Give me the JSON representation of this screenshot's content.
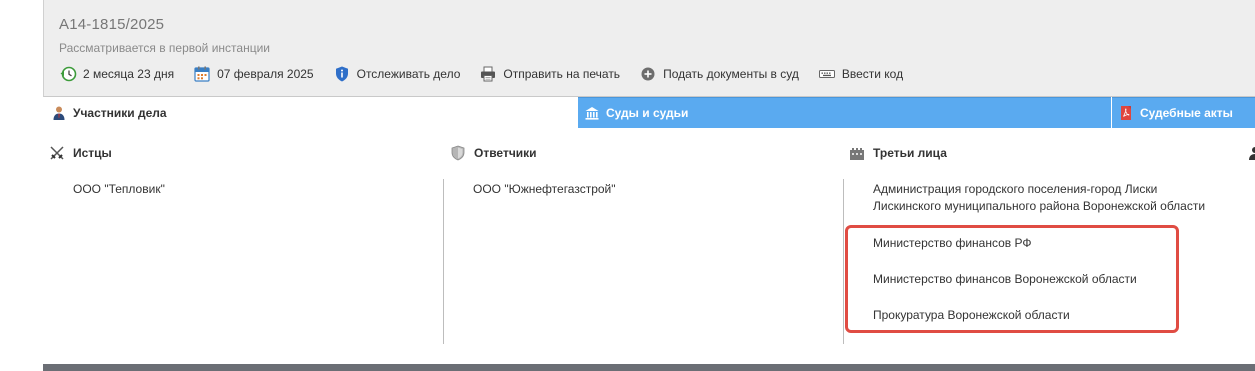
{
  "case": {
    "number": "А14-1815/2025",
    "status": "Рассматривается в первой инстанции"
  },
  "actions": [
    {
      "label": "2 месяца 23 дня",
      "icon": "clock-back-icon"
    },
    {
      "label": "07 февраля 2025",
      "icon": "calendar-icon"
    },
    {
      "label": "Отслеживать дело",
      "icon": "shield-info-icon"
    },
    {
      "label": "Отправить на печать",
      "icon": "printer-icon"
    },
    {
      "label": "Подать документы в суд",
      "icon": "plus-circle-icon"
    },
    {
      "label": "Ввести код",
      "icon": "keyboard-icon"
    }
  ],
  "tabs": {
    "participants": "Участники дела",
    "courts": "Суды и судьи",
    "acts": "Судебные акты"
  },
  "columns": {
    "plaintiffs": {
      "title": "Истцы",
      "items": [
        "ООО \"Тепловик\""
      ]
    },
    "defendants": {
      "title": "Ответчики",
      "items": [
        "ООО \"Южнефтегазстрой\""
      ]
    },
    "third_parties": {
      "title": "Третьи лица",
      "items": [
        "Администрация городского поселения-город Лиски",
        "Лискинского муниципального района Воронежской области",
        "Министерство финансов РФ",
        "Министерство финансов Воронежской области",
        "Прокуратура Воронежской области"
      ]
    }
  },
  "colors": {
    "tab_active_bg": "#5aaaf0",
    "highlight": "#e04c43",
    "header_bg": "#eeeeee"
  }
}
